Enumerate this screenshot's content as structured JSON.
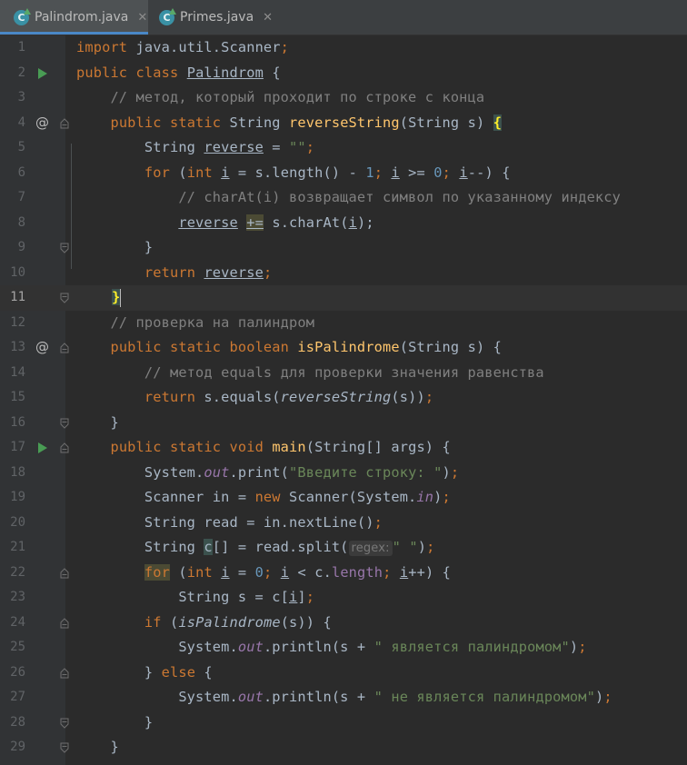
{
  "tabs": [
    {
      "label": "Palindrom.java",
      "icon": "java-class-icon",
      "active": true
    },
    {
      "label": "Primes.java",
      "icon": "java-class-icon",
      "active": false
    }
  ],
  "close_glyph": "✕",
  "class_icon_letter": "C",
  "override_glyph": "@",
  "hint_label": "regex:",
  "current_line": 11,
  "lines": {
    "n1": "1",
    "n2": "2",
    "n3": "3",
    "n4": "4",
    "n5": "5",
    "n6": "6",
    "n7": "7",
    "n8": "8",
    "n9": "9",
    "n10": "10",
    "n11": "11",
    "n12": "12",
    "n13": "13",
    "n14": "14",
    "n15": "15",
    "n16": "16",
    "n17": "17",
    "n18": "18",
    "n19": "19",
    "n20": "20",
    "n21": "21",
    "n22": "22",
    "n23": "23",
    "n24": "24",
    "n25": "25",
    "n26": "26",
    "n27": "27",
    "n28": "28",
    "n29": "29"
  },
  "code": {
    "l1": [
      "import",
      " java.util.Scanner",
      ";"
    ],
    "l2": [
      "public class",
      " ",
      "Palindrom",
      " {"
    ],
    "l3": "    // метод, который проходит по строке с конца",
    "l4": [
      "    ",
      "public static",
      " String ",
      "reverseString",
      "(String s) ",
      "{"
    ],
    "l5": [
      "        String ",
      "reverse",
      " = ",
      "\"\"",
      ";"
    ],
    "l6": [
      "        ",
      "for",
      " (",
      "int",
      " ",
      "i",
      " = s.length() - ",
      "1",
      "; ",
      "i",
      " >= ",
      "0",
      "; ",
      "i",
      "--) {"
    ],
    "l7": "            // charAt(i) возвращает символ по указанному индексу",
    "l8": [
      "            ",
      "reverse",
      " ",
      "+=",
      " s.charAt(",
      "i",
      ");"
    ],
    "l9": "        }",
    "l10": [
      "        ",
      "return",
      " ",
      "reverse",
      ";"
    ],
    "l11": "}",
    "l12": "    // проверка на палиндром",
    "l13": [
      "    ",
      "public static boolean",
      " ",
      "isPalindrome",
      "(String s) {"
    ],
    "l14": "        // метод equals для проверки значения равенства",
    "l15": [
      "        ",
      "return",
      " s.equals(",
      "reverseString",
      "(s))",
      ";"
    ],
    "l16": "    }",
    "l17": [
      "    ",
      "public static void",
      " ",
      "main",
      "(String[] args) {"
    ],
    "l18": [
      "        System.",
      "out",
      ".print(",
      "\"Введите строку: \"",
      ")",
      ";"
    ],
    "l19": [
      "        Scanner in = ",
      "new",
      " Scanner(System.",
      "in",
      ")",
      ";"
    ],
    "l20": [
      "        String read = in.nextLine()",
      ";"
    ],
    "l21": [
      "        String ",
      "c",
      "[] = read.split(",
      "\" \"",
      ")",
      ";"
    ],
    "l22": [
      "        ",
      "for",
      " (",
      "int",
      " ",
      "i",
      " = ",
      "0",
      "; ",
      "i",
      " < c.",
      "length",
      "; ",
      "i",
      "++) {"
    ],
    "l23": [
      "            String s = c[",
      "i",
      "]",
      ";"
    ],
    "l24": [
      "        ",
      "if",
      " (",
      "isPalindrome",
      "(s)) {"
    ],
    "l25": [
      "            System.",
      "out",
      ".println(s + ",
      "\" является палиндромом\"",
      ")",
      ";"
    ],
    "l26": [
      "        } ",
      "else",
      " {"
    ],
    "l27": [
      "            System.",
      "out",
      ".println(s + ",
      "\" не является палиндромом\"",
      ")",
      ";"
    ],
    "l28": "        }",
    "l29": "    }"
  },
  "colors": {
    "keyword": "#cc7832",
    "string": "#6a8759",
    "number": "#6897bb",
    "comment": "#808080",
    "method": "#ffc66d",
    "static_field": "#9876aa",
    "default": "#a9b7c6",
    "background": "#2b2b2b"
  }
}
